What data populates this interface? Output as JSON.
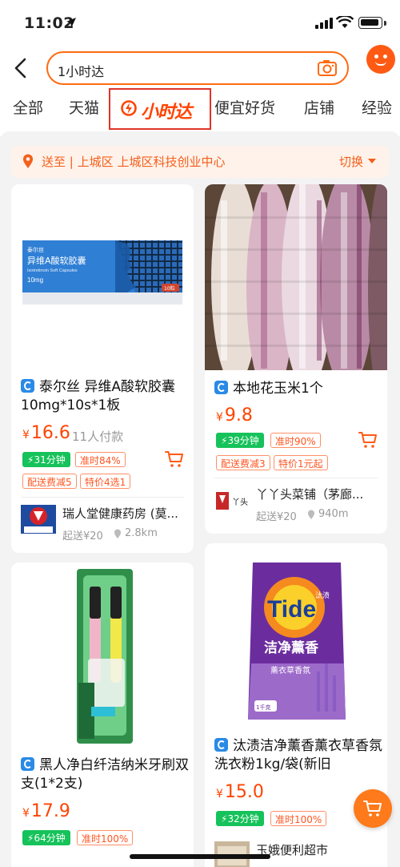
{
  "status": {
    "time": "11:02"
  },
  "search": {
    "query": "1小时达"
  },
  "tabs": [
    "全部",
    "天猫",
    "小时达",
    "便宜好货",
    "店铺",
    "经验"
  ],
  "address": {
    "prefix": "送至",
    "sep": "|",
    "district": "上城区",
    "detail": "上城区科技创业中心",
    "switch_label": "切换"
  },
  "products": [
    {
      "title": "泰尔丝 异维A酸软胶囊 10mg*10s*1板",
      "yen": "¥",
      "price": "16.6",
      "paid": "11人付款",
      "time_badge": "31分钟",
      "ontime": "准时84%",
      "promos": [
        "配送费减5",
        "特价4选1"
      ],
      "store": {
        "name": "瑞人堂健康药房 (莫...",
        "min_order": "起送¥20",
        "distance": "2.8km"
      },
      "box": {
        "brand": "泰尔丝",
        "name": "异维A酸软胶囊",
        "en": "Isotretinoin Soft Capsules",
        "dose": "10mg",
        "count": "10粒"
      }
    },
    {
      "title": "本地花玉米1个",
      "yen": "¥",
      "price": "9.8",
      "time_badge": "39分钟",
      "ontime": "准时90%",
      "promos": [
        "配送费减3",
        "特价1元起"
      ],
      "store": {
        "name": "丫丫头菜铺（茅廊...",
        "min_order": "起送¥20",
        "distance": "940m"
      }
    },
    {
      "title": "黑人净白纤洁纳米牙刷双支(1*2支)",
      "yen": "¥",
      "price": "17.9",
      "time_badge": "64分钟",
      "ontime": "准时100%"
    },
    {
      "title": "汰渍洁净薰香薰衣草香氛洗衣粉1kg/袋(新旧",
      "yen": "¥",
      "price": "15.0",
      "time_badge": "32分钟",
      "ontime": "准时100%",
      "store": {
        "name": "玉娥便利超市"
      },
      "bag": {
        "brand": "Tide",
        "cn": "汰渍",
        "line": "洁净薰香",
        "scent": "薰衣草香氛",
        "weight": "1千克"
      }
    }
  ]
}
